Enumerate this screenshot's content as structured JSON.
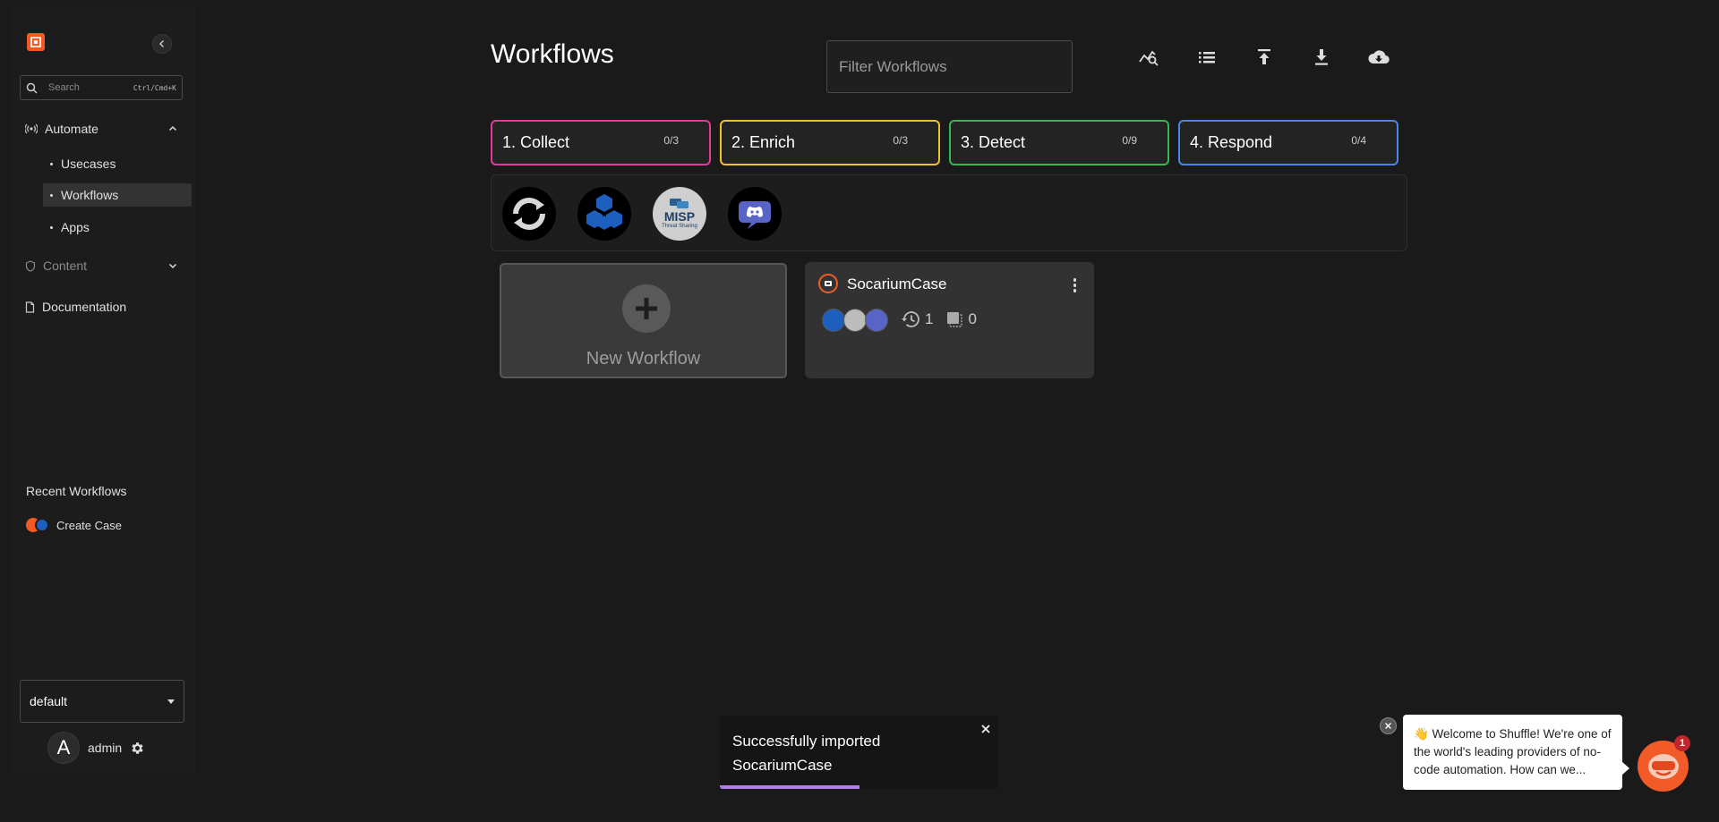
{
  "colors": {
    "background": "#1a1a1a",
    "brand": "#f15a24",
    "collect": "#e6399b",
    "enrich": "#f2c029",
    "detect": "#34b950",
    "respond": "#4a86e8",
    "toast_progress": "#b07fe6"
  },
  "sidebar": {
    "search_placeholder": "Search",
    "search_shortcut": "Ctrl/Cmd+K",
    "sections": {
      "automate": {
        "label": "Automate",
        "icon": "broadcast-icon",
        "items": [
          {
            "label": "Usecases",
            "active": false
          },
          {
            "label": "Workflows",
            "active": true
          },
          {
            "label": "Apps",
            "active": false
          }
        ]
      },
      "content": {
        "label": "Content",
        "icon": "shield-icon"
      },
      "documentation": {
        "label": "Documentation",
        "icon": "document-icon"
      }
    },
    "recent_title": "Recent Workflows",
    "recent_items": [
      {
        "label": "Create Case"
      }
    ],
    "org_select": "default",
    "user": {
      "initial": "A",
      "name": "admin"
    }
  },
  "main": {
    "title": "Workflows",
    "filter_placeholder": "Filter Workflows",
    "toolbar_icons": [
      "search-chart-icon",
      "list-icon",
      "upload-icon",
      "download-icon",
      "cloud-download-icon"
    ],
    "categories": [
      {
        "label": "1. Collect",
        "count": "0/3"
      },
      {
        "label": "2. Enrich",
        "count": "0/3"
      },
      {
        "label": "3. Detect",
        "count": "0/9"
      },
      {
        "label": "4. Respond",
        "count": "0/4"
      }
    ],
    "apps": [
      {
        "name": "sync-app",
        "icon": "sync-icon"
      },
      {
        "name": "hexagon-app",
        "icon": "hexagon-icon"
      },
      {
        "name": "misp-app",
        "title": "MISP",
        "subtitle": "Threat Sharing"
      },
      {
        "name": "discord-app",
        "icon": "discord-icon"
      }
    ],
    "new_workflow_label": "New Workflow",
    "workflows": [
      {
        "name": "SocariumCase",
        "runs": "1",
        "triggers": "0"
      }
    ]
  },
  "toast": {
    "message_line1": "Successfully imported",
    "message_line2": "SocariumCase",
    "progress": 0.5
  },
  "chat": {
    "message": "👋 Welcome to Shuffle! We're one of the world's leading providers of no-code automation. How can we...",
    "badge": "1"
  }
}
